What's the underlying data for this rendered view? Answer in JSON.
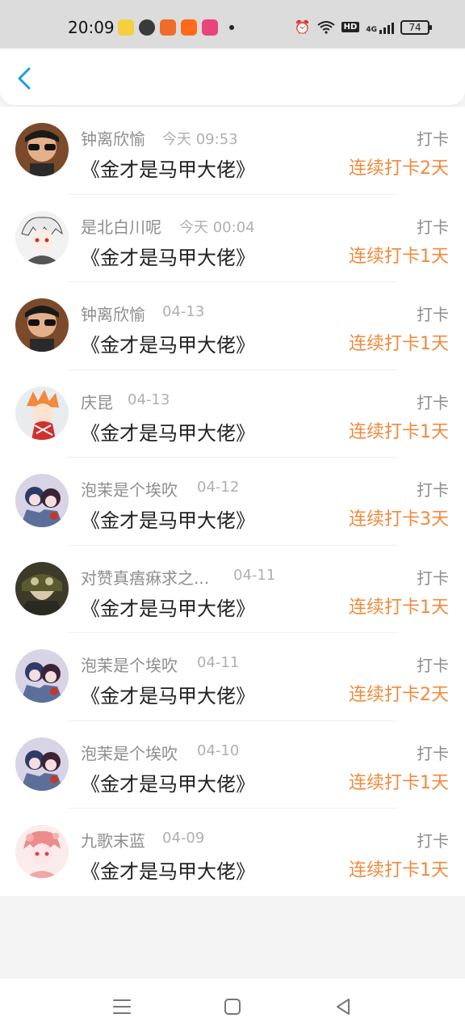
{
  "status_bar": {
    "time": "20:09",
    "network": "4G",
    "battery": "74",
    "hd": "HD"
  },
  "header": {
    "back_icon": "chevron-left-icon",
    "accent": "#1e9be9"
  },
  "colors": {
    "streak": "#ef8a3c",
    "muted": "#8e8e8e"
  },
  "items": [
    {
      "user": "钟离欣愉",
      "time": "今天 09:53",
      "book": "《金才是马甲大佬》",
      "action": "打卡",
      "streak": "连续打卡2天"
    },
    {
      "user": "是北白川呢",
      "time": "今天 00:04",
      "book": "《金才是马甲大佬》",
      "action": "打卡",
      "streak": "连续打卡1天"
    },
    {
      "user": "钟离欣愉",
      "time": "04-13",
      "book": "《金才是马甲大佬》",
      "action": "打卡",
      "streak": "连续打卡1天"
    },
    {
      "user": "庆昆",
      "time": "04-13",
      "book": "《金才是马甲大佬》",
      "action": "打卡",
      "streak": "连续打卡1天"
    },
    {
      "user": "泡茉是个埃吹",
      "time": "04-12",
      "book": "《金才是马甲大佬》",
      "action": "打卡",
      "streak": "连续打卡3天"
    },
    {
      "user": "对赞真痦痳求之...",
      "time": "04-11",
      "book": "《金才是马甲大佬》",
      "action": "打卡",
      "streak": "连续打卡1天"
    },
    {
      "user": "泡茉是个埃吹",
      "time": "04-11",
      "book": "《金才是马甲大佬》",
      "action": "打卡",
      "streak": "连续打卡2天"
    },
    {
      "user": "泡茉是个埃吹",
      "time": "04-10",
      "book": "《金才是马甲大佬》",
      "action": "打卡",
      "streak": "连续打卡1天"
    },
    {
      "user": "九歌末蓝",
      "time": "04-09",
      "book": "《金才是马甲大佬》",
      "action": "打卡",
      "streak": "连续打卡1天"
    }
  ]
}
